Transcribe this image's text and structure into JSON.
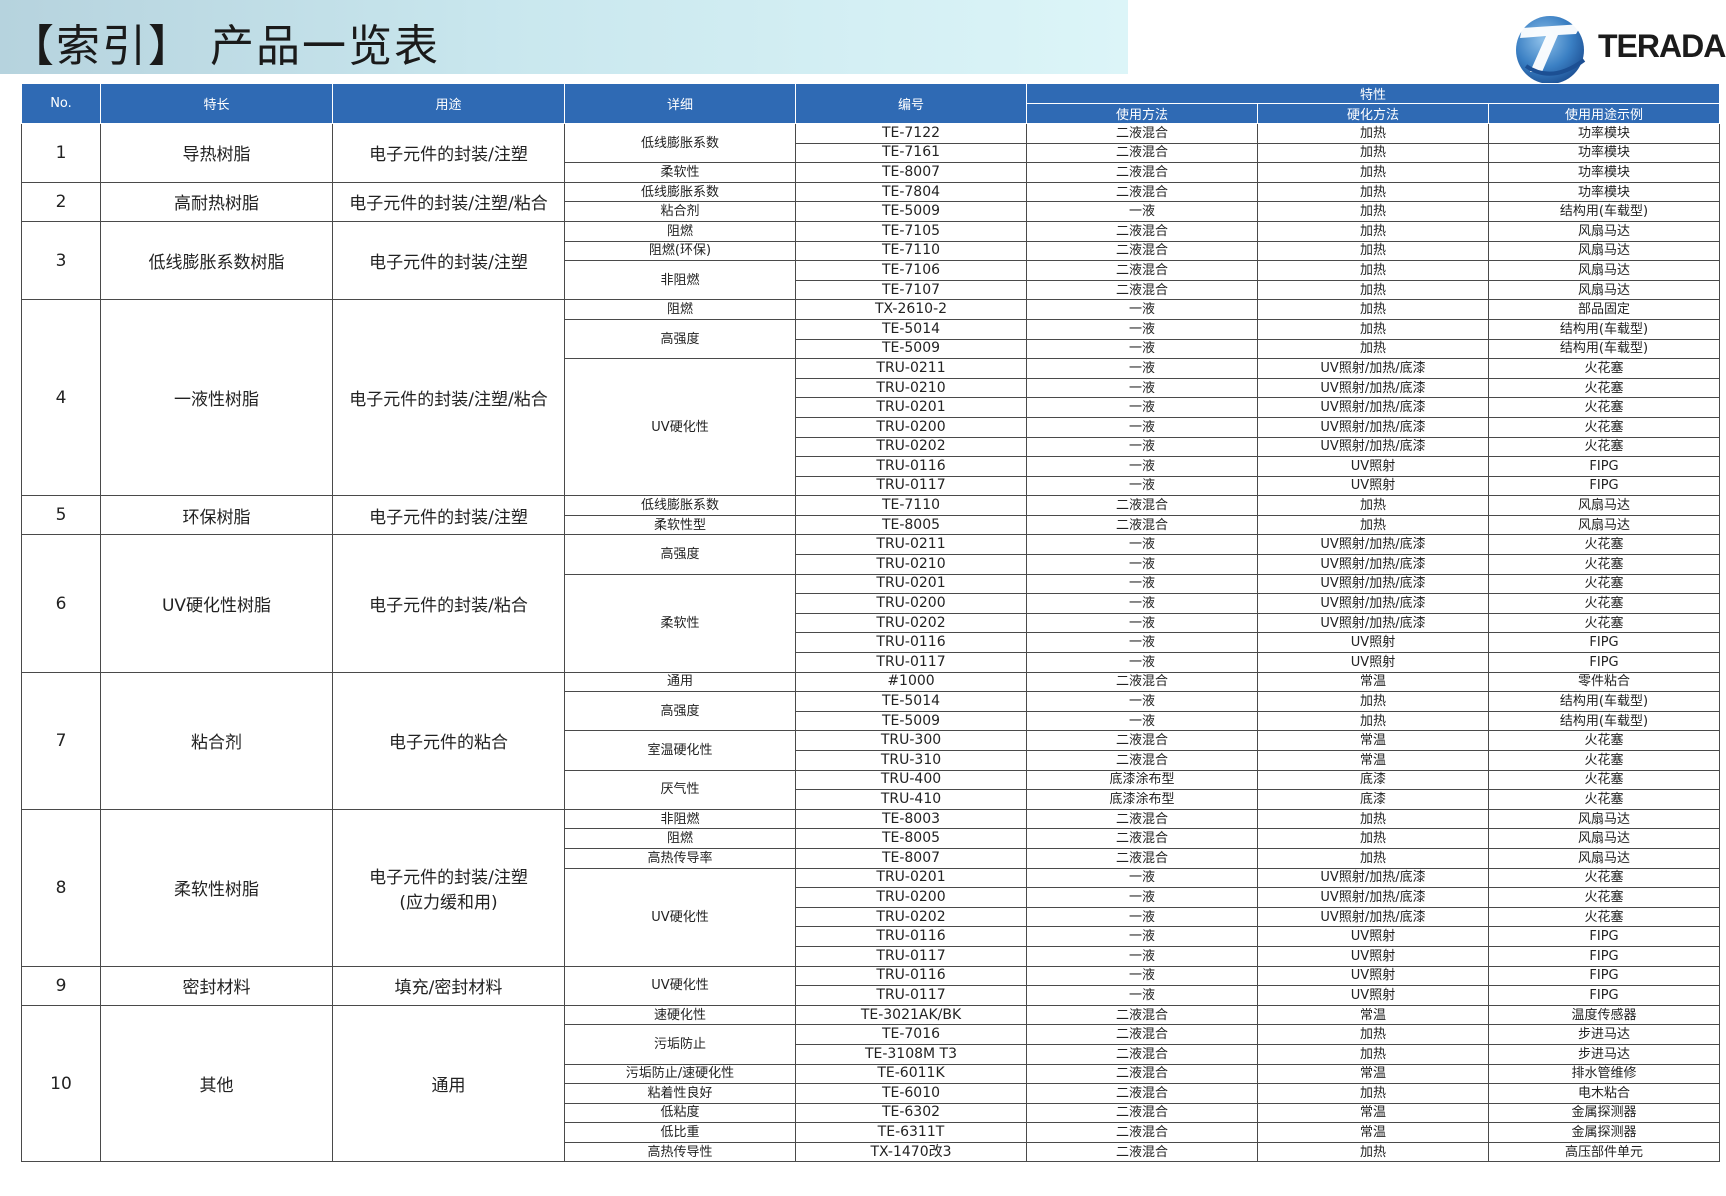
{
  "header": {
    "title": "【索引】 产品一览表",
    "logo_text": "TERADA"
  },
  "table": {
    "columns": {
      "no": "No.",
      "feature": "特长",
      "use": "用途",
      "detail": "详细",
      "code": "编号",
      "properties": "特性",
      "method": "使用方法",
      "cure": "硬化方法",
      "example": "使用用途示例"
    },
    "groups": [
      {
        "no": "1",
        "feature": "导热树脂",
        "use": "电子元件的封装/注塑",
        "details": [
          {
            "label": "低线膨胀系数",
            "rows": [
              [
                "TE-7122",
                "二液混合",
                "加热",
                "功率模块"
              ],
              [
                "TE-7161",
                "二液混合",
                "加热",
                "功率模块"
              ]
            ]
          },
          {
            "label": "柔软性",
            "rows": [
              [
                "TE-8007",
                "二液混合",
                "加热",
                "功率模块"
              ]
            ]
          }
        ]
      },
      {
        "no": "2",
        "feature": "高耐热树脂",
        "use": "电子元件的封装/注塑/粘合",
        "details": [
          {
            "label": "低线膨胀系数",
            "rows": [
              [
                "TE-7804",
                "二液混合",
                "加热",
                "功率模块"
              ]
            ]
          },
          {
            "label": "粘合剂",
            "rows": [
              [
                "TE-5009",
                "一液",
                "加热",
                "结构用(车载型)"
              ]
            ]
          }
        ]
      },
      {
        "no": "3",
        "feature": "低线膨胀系数树脂",
        "use": "电子元件的封装/注塑",
        "details": [
          {
            "label": "阻燃",
            "rows": [
              [
                "TE-7105",
                "二液混合",
                "加热",
                "风扇马达"
              ]
            ]
          },
          {
            "label": "阻燃(环保)",
            "rows": [
              [
                "TE-7110",
                "二液混合",
                "加热",
                "风扇马达"
              ]
            ]
          },
          {
            "label": "非阻燃",
            "rows": [
              [
                "TE-7106",
                "二液混合",
                "加热",
                "风扇马达"
              ],
              [
                "TE-7107",
                "二液混合",
                "加热",
                "风扇马达"
              ]
            ]
          }
        ]
      },
      {
        "no": "4",
        "feature": "一液性树脂",
        "use": "电子元件的封装/注塑/粘合",
        "details": [
          {
            "label": "阻燃",
            "rows": [
              [
                "TX-2610-2",
                "一液",
                "加热",
                "部品固定"
              ]
            ]
          },
          {
            "label": "高强度",
            "rows": [
              [
                "TE-5014",
                "一液",
                "加热",
                "结构用(车载型)"
              ],
              [
                "TE-5009",
                "一液",
                "加热",
                "结构用(车载型)"
              ]
            ]
          },
          {
            "label": "UV硬化性",
            "rows": [
              [
                "TRU-0211",
                "一液",
                "UV照射/加热/底漆",
                "火花塞"
              ],
              [
                "TRU-0210",
                "一液",
                "UV照射/加热/底漆",
                "火花塞"
              ],
              [
                "TRU-0201",
                "一液",
                "UV照射/加热/底漆",
                "火花塞"
              ],
              [
                "TRU-0200",
                "一液",
                "UV照射/加热/底漆",
                "火花塞"
              ],
              [
                "TRU-0202",
                "一液",
                "UV照射/加热/底漆",
                "火花塞"
              ],
              [
                "TRU-0116",
                "一液",
                "UV照射",
                "FIPG"
              ],
              [
                "TRU-0117",
                "一液",
                "UV照射",
                "FIPG"
              ]
            ]
          }
        ]
      },
      {
        "no": "5",
        "feature": "环保树脂",
        "use": "电子元件的封装/注塑",
        "details": [
          {
            "label": "低线膨胀系数",
            "rows": [
              [
                "TE-7110",
                "二液混合",
                "加热",
                "风扇马达"
              ]
            ]
          },
          {
            "label": "柔软性型",
            "rows": [
              [
                "TE-8005",
                "二液混合",
                "加热",
                "风扇马达"
              ]
            ]
          }
        ]
      },
      {
        "no": "6",
        "feature": "UV硬化性树脂",
        "use": "电子元件的封装/粘合",
        "details": [
          {
            "label": "高强度",
            "rows": [
              [
                "TRU-0211",
                "一液",
                "UV照射/加热/底漆",
                "火花塞"
              ],
              [
                "TRU-0210",
                "一液",
                "UV照射/加热/底漆",
                "火花塞"
              ]
            ]
          },
          {
            "label": "柔软性",
            "rows": [
              [
                "TRU-0201",
                "一液",
                "UV照射/加热/底漆",
                "火花塞"
              ],
              [
                "TRU-0200",
                "一液",
                "UV照射/加热/底漆",
                "火花塞"
              ],
              [
                "TRU-0202",
                "一液",
                "UV照射/加热/底漆",
                "火花塞"
              ],
              [
                "TRU-0116",
                "一液",
                "UV照射",
                "FIPG"
              ],
              [
                "TRU-0117",
                "一液",
                "UV照射",
                "FIPG"
              ]
            ]
          }
        ]
      },
      {
        "no": "7",
        "feature": "粘合剂",
        "use": "电子元件的粘合",
        "details": [
          {
            "label": "通用",
            "rows": [
              [
                "#1000",
                "二液混合",
                "常温",
                "零件粘合"
              ]
            ]
          },
          {
            "label": "高强度",
            "rows": [
              [
                "TE-5014",
                "一液",
                "加热",
                "结构用(车载型)"
              ],
              [
                "TE-5009",
                "一液",
                "加热",
                "结构用(车载型)"
              ]
            ]
          },
          {
            "label": "室温硬化性",
            "rows": [
              [
                "TRU-300",
                "二液混合",
                "常温",
                "火花塞"
              ],
              [
                "TRU-310",
                "二液混合",
                "常温",
                "火花塞"
              ]
            ]
          },
          {
            "label": "厌气性",
            "rows": [
              [
                "TRU-400",
                "底漆涂布型",
                "底漆",
                "火花塞"
              ],
              [
                "TRU-410",
                "底漆涂布型",
                "底漆",
                "火花塞"
              ]
            ]
          }
        ]
      },
      {
        "no": "8",
        "feature": "柔软性树脂",
        "use": "电子元件的封装/注塑\n(应力缓和用)",
        "details": [
          {
            "label": "非阻燃",
            "rows": [
              [
                "TE-8003",
                "二液混合",
                "加热",
                "风扇马达"
              ]
            ]
          },
          {
            "label": "阻燃",
            "rows": [
              [
                "TE-8005",
                "二液混合",
                "加热",
                "风扇马达"
              ]
            ]
          },
          {
            "label": "高热传导率",
            "rows": [
              [
                "TE-8007",
                "二液混合",
                "加热",
                "风扇马达"
              ]
            ]
          },
          {
            "label": "UV硬化性",
            "rows": [
              [
                "TRU-0201",
                "一液",
                "UV照射/加热/底漆",
                "火花塞"
              ],
              [
                "TRU-0200",
                "一液",
                "UV照射/加热/底漆",
                "火花塞"
              ],
              [
                "TRU-0202",
                "一液",
                "UV照射/加热/底漆",
                "火花塞"
              ],
              [
                "TRU-0116",
                "一液",
                "UV照射",
                "FIPG"
              ],
              [
                "TRU-0117",
                "一液",
                "UV照射",
                "FIPG"
              ]
            ]
          }
        ]
      },
      {
        "no": "9",
        "feature": "密封材料",
        "use": "填充/密封材料",
        "details": [
          {
            "label": "UV硬化性",
            "rows": [
              [
                "TRU-0116",
                "一液",
                "UV照射",
                "FIPG"
              ],
              [
                "TRU-0117",
                "一液",
                "UV照射",
                "FIPG"
              ]
            ]
          }
        ]
      },
      {
        "no": "10",
        "feature": "其他",
        "use": "通用",
        "details": [
          {
            "label": "速硬化性",
            "rows": [
              [
                "TE-3021AK/BK",
                "二液混合",
                "常温",
                "温度传感器"
              ]
            ]
          },
          {
            "label": "污垢防止",
            "rows": [
              [
                "TE-7016",
                "二液混合",
                "加热",
                "步进马达"
              ],
              [
                "TE-3108M T3",
                "二液混合",
                "加热",
                "步进马达"
              ]
            ]
          },
          {
            "label": "污垢防止/速硬化性",
            "rows": [
              [
                "TE-6011K",
                "二液混合",
                "常温",
                "排水管维修"
              ]
            ]
          },
          {
            "label": "粘着性良好",
            "rows": [
              [
                "TE-6010",
                "二液混合",
                "加热",
                "电木粘合"
              ]
            ]
          },
          {
            "label": "低粘度",
            "rows": [
              [
                "TE-6302",
                "二液混合",
                "常温",
                "金属探测器"
              ]
            ]
          },
          {
            "label": "低比重",
            "rows": [
              [
                "TE-6311T",
                "二液混合",
                "常温",
                "金属探测器"
              ]
            ]
          },
          {
            "label": "高热传导性",
            "rows": [
              [
                "TX-1470改3",
                "二液混合",
                "加热",
                "高压部件单元"
              ]
            ]
          }
        ]
      }
    ]
  },
  "colors": {
    "header_blue": "#2f6ab4",
    "title_band": "#c9e7ee",
    "logo_blue": "#2c6fb8"
  },
  "icons": {
    "logo": "terada-swoosh-logo"
  }
}
